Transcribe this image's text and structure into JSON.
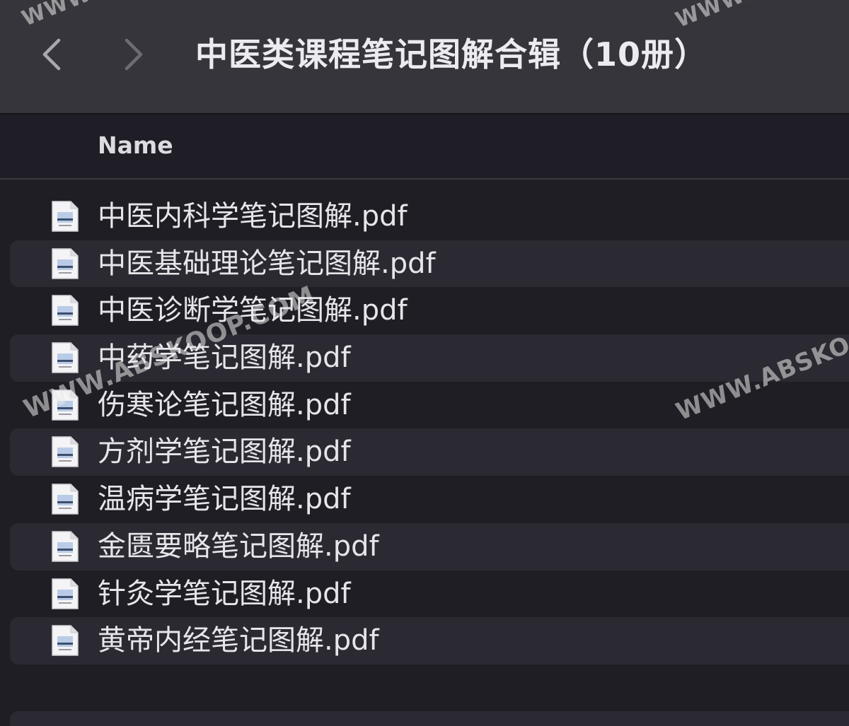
{
  "toolbar": {
    "title": "中医类课程笔记图解合辑（10册）",
    "back_icon": "chevron-left-icon",
    "forward_icon": "chevron-right-icon"
  },
  "header": {
    "name_column": "Name"
  },
  "files": [
    {
      "name": "中医内科学笔记图解.pdf"
    },
    {
      "name": "中医基础理论笔记图解.pdf"
    },
    {
      "name": "中医诊断学笔记图解.pdf"
    },
    {
      "name": "中药学笔记图解.pdf"
    },
    {
      "name": "伤寒论笔记图解.pdf"
    },
    {
      "name": "方剂学笔记图解.pdf"
    },
    {
      "name": "温病学笔记图解.pdf"
    },
    {
      "name": "金匮要略笔记图解.pdf"
    },
    {
      "name": "针灸学笔记图解.pdf"
    },
    {
      "name": "黄帝内经笔记图解.pdf"
    }
  ],
  "watermarks": [
    "WWW.ABSKOOP.COM",
    "WWW.ABSKO",
    "WWW.",
    "WWW."
  ],
  "colors": {
    "toolbar": "#36353b",
    "background": "#1e1e24",
    "row_alt": "#2b2a32",
    "text": "#e6e6ea"
  }
}
